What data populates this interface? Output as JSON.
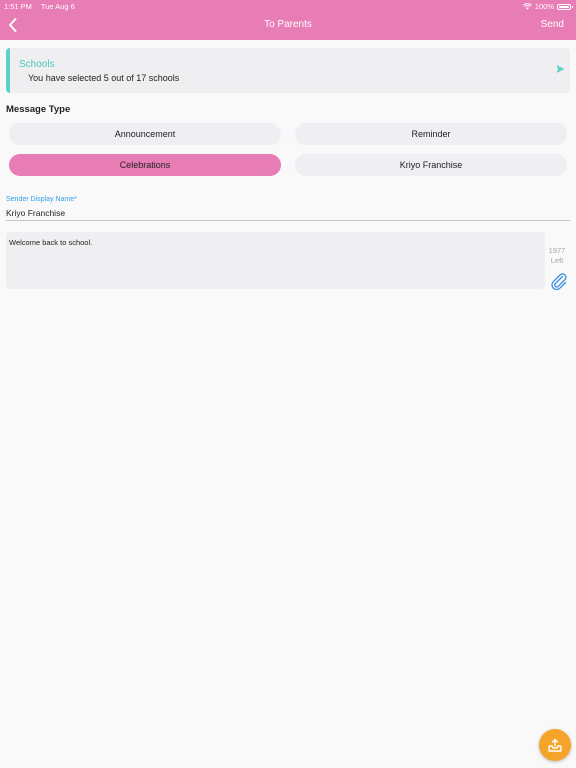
{
  "status_bar": {
    "time": "1:51 PM",
    "date": "Tue Aug 6",
    "battery": "100%"
  },
  "header": {
    "title": "To Parents",
    "send_label": "Send"
  },
  "schools": {
    "title": "Schools",
    "subtitle": "You have selected 5 out of 17 schools"
  },
  "message_type": {
    "label": "Message Type",
    "options": [
      "Announcement",
      "Reminder",
      "Celebrations",
      "Kriyo Franchise"
    ],
    "selected": "Celebrations"
  },
  "sender": {
    "label": "Sender Display Name*",
    "value": "Kriyo Franchise"
  },
  "message": {
    "text": "Welcome back to school.",
    "chars_left": "1977",
    "left_label": "Left"
  },
  "colors": {
    "header": "#e87cb5",
    "accent_teal": "#5cd1c7",
    "link_blue": "#2f9ee8",
    "fab": "#f5a42a"
  }
}
